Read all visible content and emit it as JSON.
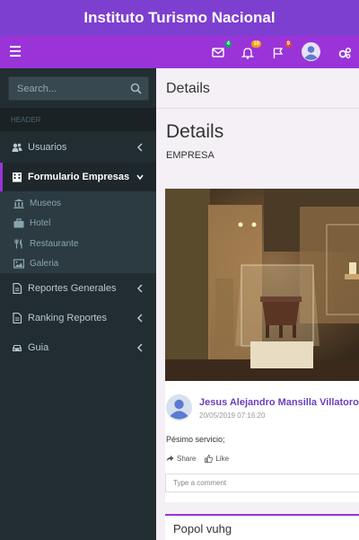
{
  "app": {
    "title": "Instituto Turismo Nacional"
  },
  "navbar": {
    "messages_badge": "4",
    "notifications_badge": "10",
    "flags_badge": "9",
    "colors": {
      "brand": "#7d3fd0",
      "toolbar": "#9a34d8",
      "badge_green": "#00a65a",
      "badge_yellow": "#f39c12",
      "badge_red": "#dd4b39"
    }
  },
  "sidebar": {
    "search_placeholder": "Search...",
    "header": "HEADER",
    "items": [
      {
        "label": "Usuarios",
        "icon": "users-icon"
      },
      {
        "label": "Formulario Empresas",
        "icon": "building-icon"
      },
      {
        "label": "Reportes Generales",
        "icon": "file-icon"
      },
      {
        "label": "Ranking Reportes",
        "icon": "file-icon"
      },
      {
        "label": "Guia",
        "icon": "car-icon"
      }
    ],
    "subitems": [
      {
        "label": "Museos",
        "icon": "bank-icon"
      },
      {
        "label": "Hotel",
        "icon": "briefcase-icon"
      },
      {
        "label": "Restaurante",
        "icon": "cutlery-icon"
      },
      {
        "label": "Galeria",
        "icon": "picture-icon"
      }
    ]
  },
  "content": {
    "breadcrumb_title": "Details",
    "page_title": "Details",
    "page_subtitle": "EMPRESA",
    "post": {
      "author": "Jesus Alejandro Mansilla Villatoro",
      "timestamp": "20/05/2019 07:16:20",
      "comment": "Pésimo servicio;",
      "share_label": "Share",
      "like_label": "Like",
      "comment_placeholder": "Type a comment"
    },
    "box2_title": "Popol vuhg"
  }
}
